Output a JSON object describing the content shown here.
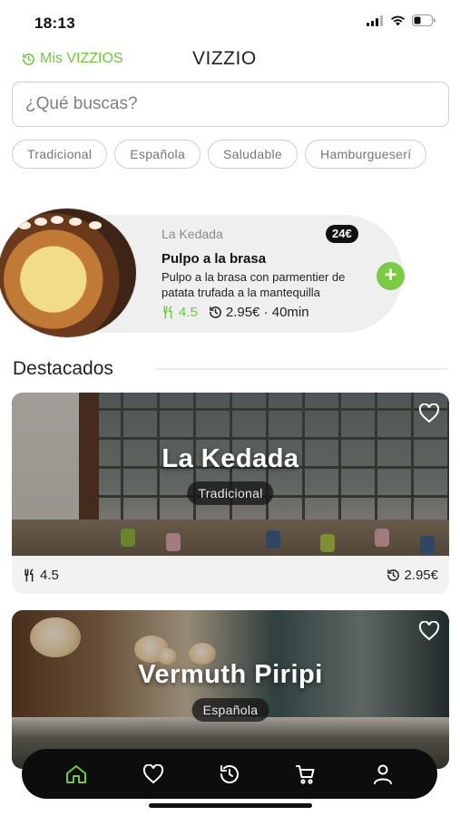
{
  "status_bar": {
    "time": "18:13"
  },
  "header": {
    "mis_vizzios": "Mis VIZZIOS",
    "app_title": "VIZZIO"
  },
  "search": {
    "placeholder": "¿Qué buscas?"
  },
  "categories": [
    "Tradicional",
    "Española",
    "Saludable",
    "Hamburgueserí"
  ],
  "promo": {
    "restaurant": "La Kedada",
    "price": "24€",
    "dish": "Pulpo a la brasa",
    "description": "Pulpo a la brasa con parmentier de patata trufada a la mantequilla",
    "rating": "4.5",
    "delivery": "2.95€ · 40min"
  },
  "featured": {
    "title": "Destacados",
    "cards": [
      {
        "name": "La Kedada",
        "tag": "Tradicional",
        "rating": "4.5",
        "delivery_price": "2.95€"
      },
      {
        "name": "Vermuth Piripi",
        "tag": "Española"
      }
    ]
  },
  "tabs": [
    "home",
    "favorites",
    "history",
    "cart",
    "profile"
  ],
  "colors": {
    "accent": "#6bcb3a",
    "tab_bar": "#0d0d0d"
  }
}
